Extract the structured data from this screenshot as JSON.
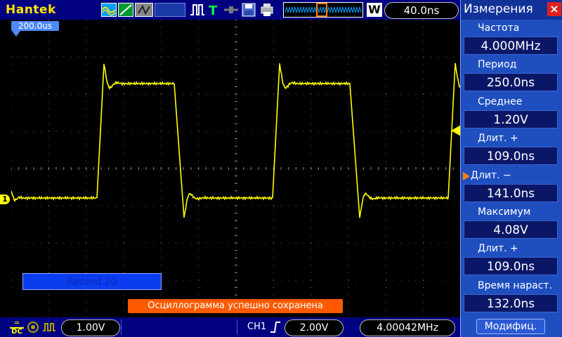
{
  "topbar": {
    "brand": "Hantek",
    "timebase": "40.0ns"
  },
  "screen": {
    "offset_tag": "200.0us",
    "channel_marker": "1",
    "record_text": "Record  20",
    "save_message": "Осциллограмма успешно сохранена",
    "trace_color": "#ffff00",
    "grid_color": "#808080"
  },
  "bottombar": {
    "ch1_scale": "1.00V",
    "trigger_source": "CH1",
    "trigger_level": "2.00V",
    "frequency": "4.00042MHz"
  },
  "panel": {
    "title": "Измерения",
    "close_icon": "×",
    "items": [
      {
        "label": "Частота",
        "value": "4.000MHz"
      },
      {
        "label": "Период",
        "value": "250.0ns"
      },
      {
        "label": "Среднее",
        "value": "1.20V"
      },
      {
        "label": "Длит. +",
        "value": "109.0ns"
      },
      {
        "label": "Длит. −",
        "value": "141.0ns"
      },
      {
        "label": "Максимум",
        "value": "4.08V"
      },
      {
        "label": "Длит. +",
        "value": "109.0ns"
      },
      {
        "label": "Время нараст.",
        "value": "132.0ns"
      }
    ],
    "modify_label": "Модифиц."
  }
}
